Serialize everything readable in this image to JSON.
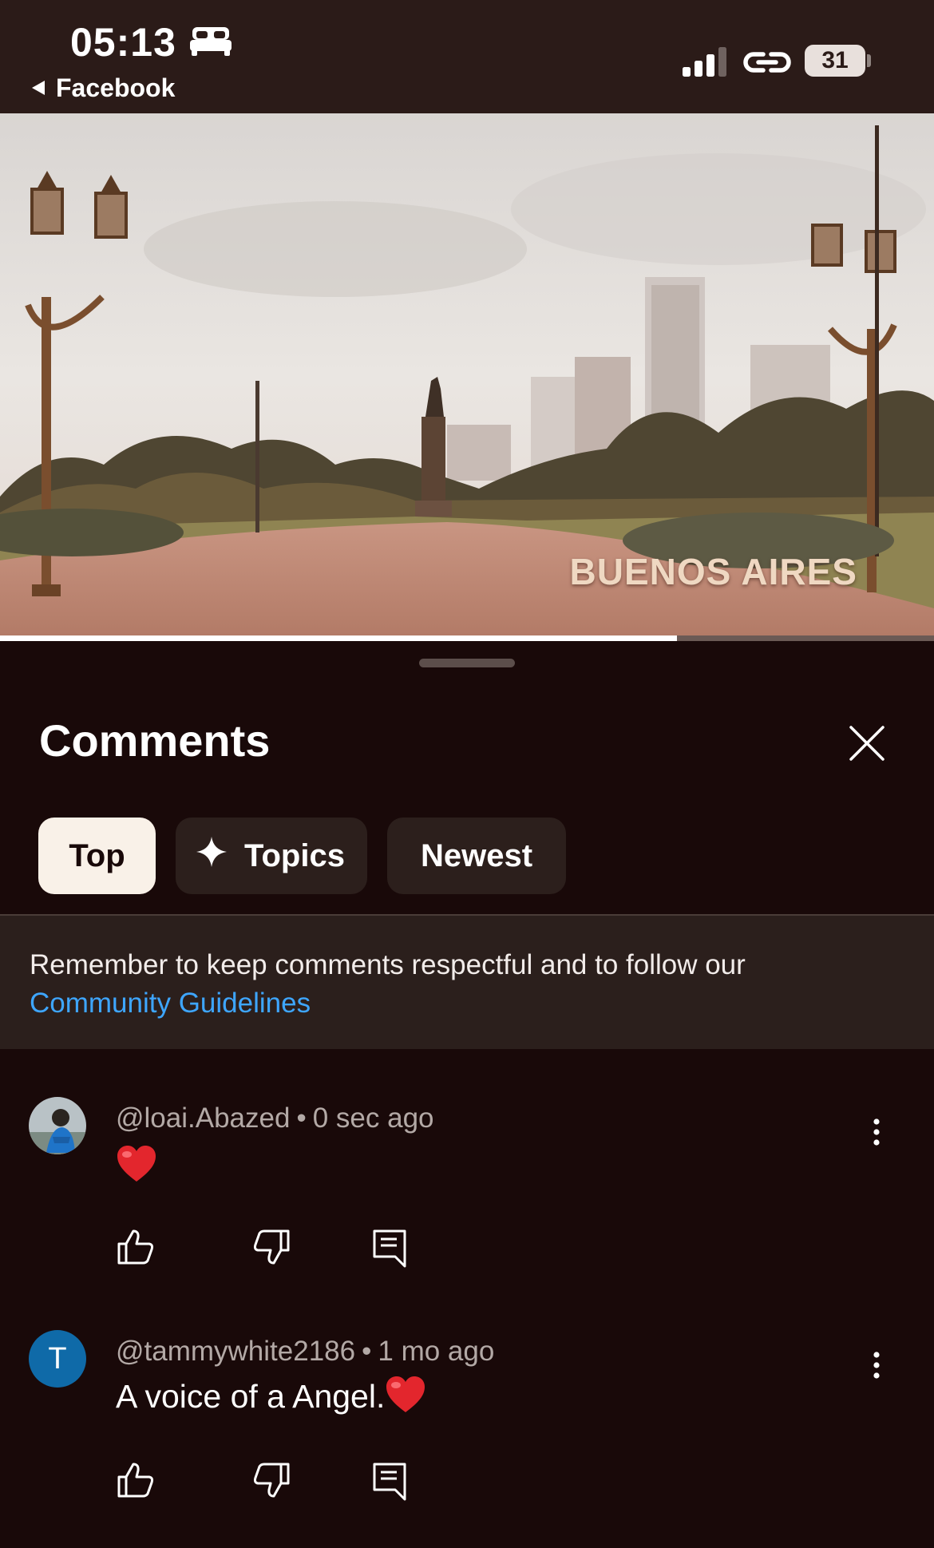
{
  "status_bar": {
    "time": "05:13",
    "back_app": "Facebook",
    "battery": "31",
    "icons": [
      "bed-icon",
      "signal-icon",
      "link-icon",
      "battery-icon",
      "back-triangle-icon"
    ]
  },
  "video": {
    "caption": "BUENOS AIRES",
    "progress": 0.725
  },
  "comments_sheet": {
    "title": "Comments",
    "close_icon": "close-icon",
    "filters": [
      {
        "label": "Top",
        "active": true
      },
      {
        "label": "Topics",
        "icon": "sparkle-icon",
        "active": false
      },
      {
        "label": "Newest",
        "active": false
      }
    ],
    "notice": {
      "text": "Remember to keep comments respectful and to follow our",
      "link": "Community Guidelines"
    }
  },
  "comments": [
    {
      "author": "@loai.Abazed",
      "time": "0 sec ago",
      "text": "",
      "emoji": "heart",
      "avatar": "photo"
    },
    {
      "author": "@tammywhite2186",
      "time": "1 mo ago",
      "text": "A voice of a Angel.",
      "emoji": "heart",
      "avatar_letter": "T",
      "avatar_color": "#0f6aa8"
    }
  ],
  "colors": {
    "background": "#190909",
    "status_bar": "#2b1b18",
    "chip": "#2c1f1c",
    "chip_active": "#f9f1e8",
    "link": "#3ea6ff",
    "meta_text": "#b3a9a6"
  }
}
